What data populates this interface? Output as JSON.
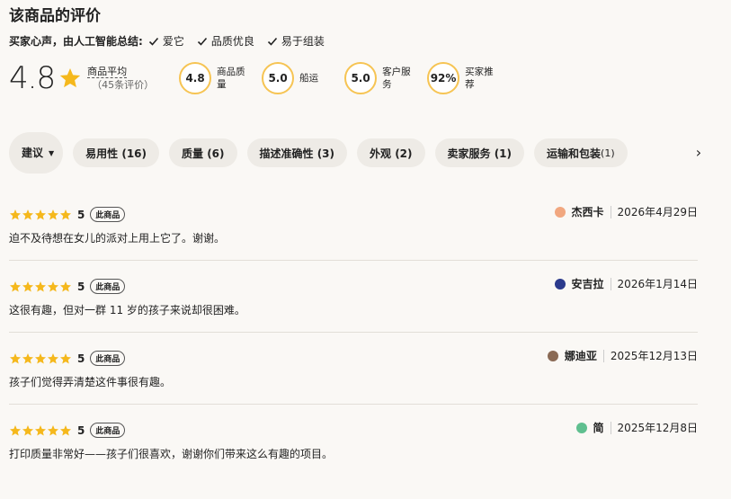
{
  "title": "该商品的评价",
  "summary": {
    "label": "买家心声，由人工智能总结:",
    "tags": [
      "爱它",
      "品质优良",
      "易于组装"
    ]
  },
  "rating": {
    "score": "4.8",
    "avg_label": "商品平均",
    "count_text": "（45条评价）"
  },
  "metrics": [
    {
      "value": "4.8",
      "label": "商品质量",
      "level": 0.96
    },
    {
      "value": "5.0",
      "label": "船运",
      "level": 1.0
    },
    {
      "value": "5.0",
      "label": "客户服务",
      "level": 1.0
    },
    {
      "value": "92%",
      "label": "买家推荐",
      "level": 0.92
    }
  ],
  "filters": {
    "sort_label": "建议",
    "chips": [
      "易用性 (16)",
      "质量 (6)",
      "描述准确性 (3)",
      "外观 (2)",
      "卖家服务 (1)"
    ],
    "last_chip": {
      "label": "运输和包装",
      "count": "(1)"
    }
  },
  "badge_label": "此商品",
  "reviews": [
    {
      "score": "5",
      "reviewer": "杰西卡",
      "date": "2026年4月29日",
      "text": "迫不及待想在女儿的派对上用上它了。谢谢。",
      "avatar_color": "#f1a77f"
    },
    {
      "score": "5",
      "reviewer": "安吉拉",
      "date": "2026年1月14日",
      "text": "这很有趣，但对一群 11 岁的孩子来说却很困难。",
      "avatar_color": "#2b3a8c"
    },
    {
      "score": "5",
      "reviewer": "娜迪亚",
      "date": "2025年12月13日",
      "text": "孩子们觉得弄清楚这件事很有趣。",
      "avatar_color": "#8a6a55"
    },
    {
      "score": "5",
      "reviewer": "简",
      "date": "2025年12月8日",
      "text": "打印质量非常好——孩子们很喜欢，谢谢你们带来这么有趣的项目。",
      "avatar_color": "#5fbf8f"
    }
  ],
  "colors": {
    "star": "#f5b81c",
    "ring": "#f6c453"
  },
  "icons": {
    "check": "check-icon",
    "star": "star-icon",
    "next": "chevron-right-icon",
    "sort_caret": "caret-down-icon"
  }
}
